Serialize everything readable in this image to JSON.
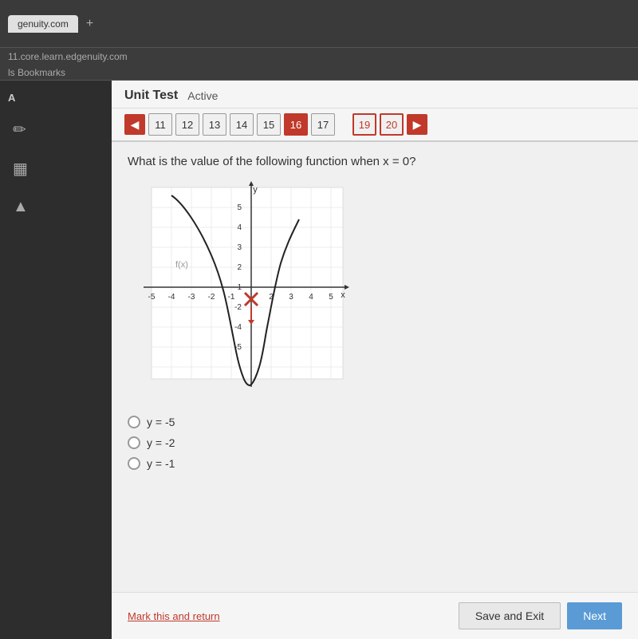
{
  "browser": {
    "tab_text": "genuity.com",
    "tab_plus": "+",
    "address": "11.core.learn.edgenuity.com",
    "bookmarks_label": "ls Bookmarks"
  },
  "sidebar": {
    "label": "A",
    "pencil_icon": "✏",
    "calc_icon": "▦",
    "arrow_icon": "▲"
  },
  "header": {
    "unit_test_label": "Unit Test",
    "active_label": "Active"
  },
  "nav": {
    "prev_arrow": "◀",
    "next_arrow": "▶",
    "questions": [
      "11",
      "12",
      "13",
      "14",
      "15",
      "16",
      "17",
      "19",
      "20"
    ]
  },
  "question": {
    "text": "What is the value of the following function when x = 0?",
    "graph_label_fx": "f(x)",
    "graph_label_y": "y",
    "graph_label_x": "x"
  },
  "answers": [
    {
      "label": "y = -5",
      "selected": false
    },
    {
      "label": "y = -2",
      "selected": false
    },
    {
      "label": "y = -1",
      "selected": false
    }
  ],
  "footer": {
    "mark_return": "Mark this and return",
    "save_exit": "Save and Exit",
    "next_label": "Next"
  }
}
